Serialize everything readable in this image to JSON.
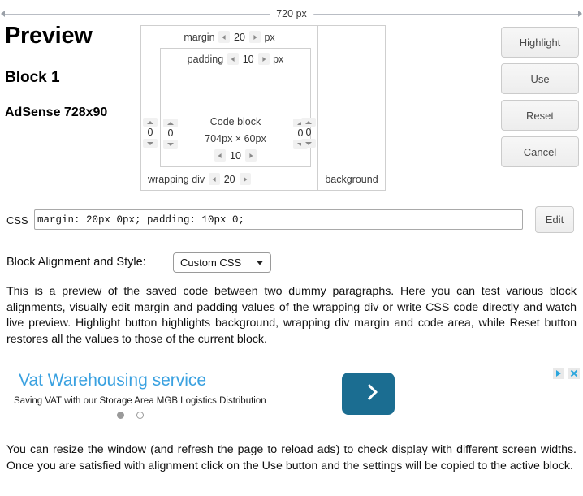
{
  "ruler": {
    "label": "720 px"
  },
  "headings": {
    "preview": "Preview",
    "block": "Block 1",
    "adsense": "AdSense 728x90"
  },
  "boxmodel": {
    "margin_label": "margin",
    "margin_value": "20",
    "margin_unit": "px",
    "padding_label": "padding",
    "padding_value": "10",
    "padding_unit": "px",
    "code_block_label": "Code block",
    "code_block_size": "704px × 60px",
    "left_margin_value": "0",
    "left_padding_value": "0",
    "right_padding_value": "0",
    "right_margin_value": "0",
    "bottom_padding_value": "10",
    "wrapping_div_label": "wrapping div",
    "bottom_margin_value": "20",
    "background_label": "background"
  },
  "buttons": {
    "highlight": "Highlight",
    "use": "Use",
    "reset": "Reset",
    "cancel": "Cancel"
  },
  "css": {
    "label": "CSS",
    "value": "margin: 20px 0px; padding: 10px 0;",
    "placeholder": "",
    "edit_label": "Edit"
  },
  "alignment": {
    "label": "Block Alignment and Style:",
    "selected": "Custom CSS"
  },
  "paragraphs": {
    "first": "This is a preview of the saved code between two dummy paragraphs. Here you can test various block alignments, visually edit margin and padding values of the wrapping div or write CSS code directly and watch live preview. Highlight button highlights background, wrapping div margin and code area, while Reset button restores all the values to those of the current block.",
    "second": "You can resize the window (and refresh the page to reload ads) to check display with different screen widths. Once you are satisfied with alignment click on the Use button and the settings will be copied to the active block."
  },
  "ad": {
    "title": "Vat Warehousing service",
    "description": "Saving VAT with our Storage Area MGB Logistics Distribution",
    "cta_icon": "chevron-right-icon",
    "adchoices_icon": "adchoices-icon",
    "close_icon": "close-icon"
  },
  "colors": {
    "ad_title": "#3aa1e0",
    "ad_cta": "#1b6d91",
    "ad_icon": "#2ba6dd",
    "border": "#cfcfcf"
  }
}
